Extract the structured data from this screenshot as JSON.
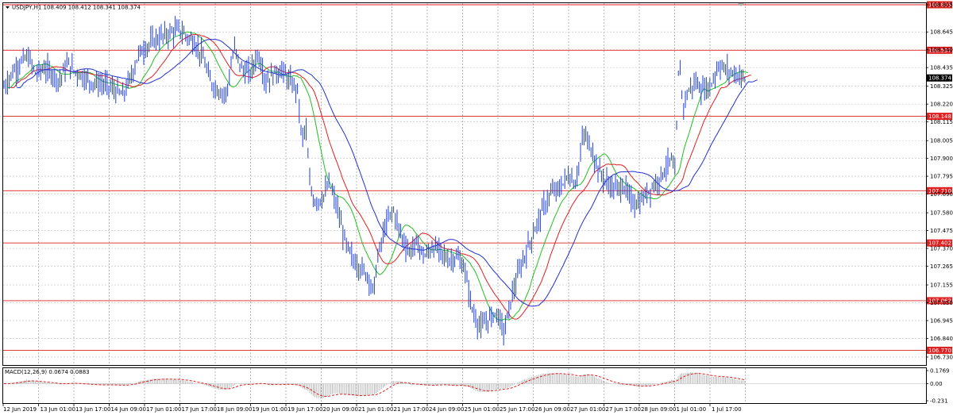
{
  "chart_data": {
    "type": "line",
    "main": {
      "header": "USDJPY,H1  108.409 108.412 108.341 108.374",
      "bid_label": "108.374",
      "bid": 108.374,
      "ylim": [
        106.73,
        108.805
      ],
      "yticks": [
        "108.805",
        "108.645",
        "108.540",
        "108.435",
        "108.325",
        "108.220",
        "108.115",
        "108.005",
        "107.900",
        "107.795",
        "107.690",
        "107.580",
        "107.475",
        "107.370",
        "107.265",
        "107.155",
        "107.050",
        "106.945",
        "106.840",
        "106.730"
      ],
      "levels": [
        {
          "label": "108.805",
          "value": 108.805
        },
        {
          "label": "108.537",
          "value": 108.537
        },
        {
          "label": "108.148",
          "value": 108.148
        },
        {
          "label": "107.710",
          "value": 107.71
        },
        {
          "label": "107.402",
          "value": 107.402
        },
        {
          "label": "107.062",
          "value": 107.062
        },
        {
          "label": "106.770",
          "value": 106.77
        }
      ],
      "line_colors": {
        "price": "#1f3fd6",
        "level": "#e02020",
        "ma_fast": "#22c022",
        "ma_mid": "#e02020",
        "ma_slow": "#2030d0"
      },
      "price_anchors": [
        [
          0,
          108.32
        ],
        [
          10,
          108.4
        ],
        [
          20,
          108.46
        ],
        [
          30,
          108.5
        ],
        [
          40,
          108.4
        ],
        [
          50,
          108.43
        ],
        [
          60,
          108.4
        ],
        [
          70,
          108.36
        ],
        [
          80,
          108.46
        ],
        [
          90,
          108.41
        ],
        [
          100,
          108.38
        ],
        [
          110,
          108.35
        ],
        [
          120,
          108.34
        ],
        [
          130,
          108.33
        ],
        [
          140,
          108.3
        ],
        [
          150,
          108.27
        ],
        [
          160,
          108.38
        ],
        [
          170,
          108.52
        ],
        [
          180,
          108.56
        ],
        [
          190,
          108.6
        ],
        [
          200,
          108.62
        ],
        [
          210,
          108.64
        ],
        [
          220,
          108.66
        ],
        [
          230,
          108.62
        ],
        [
          240,
          108.58
        ],
        [
          250,
          108.5
        ],
        [
          260,
          108.35
        ],
        [
          270,
          108.3
        ],
        [
          280,
          108.28
        ],
        [
          290,
          108.55
        ],
        [
          300,
          108.42
        ],
        [
          310,
          108.4
        ],
        [
          320,
          108.52
        ],
        [
          330,
          108.35
        ],
        [
          340,
          108.4
        ],
        [
          350,
          108.42
        ],
        [
          360,
          108.35
        ],
        [
          370,
          108.3
        ],
        [
          375,
          108.0
        ],
        [
          380,
          108.1
        ],
        [
          385,
          107.75
        ],
        [
          390,
          107.65
        ],
        [
          400,
          107.66
        ],
        [
          410,
          107.75
        ],
        [
          420,
          107.6
        ],
        [
          430,
          107.4
        ],
        [
          440,
          107.3
        ],
        [
          450,
          107.25
        ],
        [
          460,
          107.2
        ],
        [
          465,
          107.1
        ],
        [
          470,
          107.3
        ],
        [
          480,
          107.5
        ],
        [
          490,
          107.6
        ],
        [
          500,
          107.45
        ],
        [
          510,
          107.35
        ],
        [
          520,
          107.4
        ],
        [
          530,
          107.32
        ],
        [
          540,
          107.38
        ],
        [
          550,
          107.35
        ],
        [
          560,
          107.3
        ],
        [
          570,
          107.32
        ],
        [
          580,
          107.25
        ],
        [
          590,
          107.0
        ],
        [
          600,
          106.9
        ],
        [
          610,
          106.95
        ],
        [
          620,
          107.0
        ],
        [
          630,
          106.88
        ],
        [
          640,
          107.1
        ],
        [
          650,
          107.25
        ],
        [
          660,
          107.38
        ],
        [
          670,
          107.5
        ],
        [
          680,
          107.62
        ],
        [
          690,
          107.7
        ],
        [
          700,
          107.72
        ],
        [
          710,
          107.8
        ],
        [
          720,
          107.75
        ],
        [
          730,
          108.05
        ],
        [
          740,
          107.95
        ],
        [
          750,
          107.82
        ],
        [
          760,
          107.75
        ],
        [
          770,
          107.72
        ],
        [
          780,
          107.74
        ],
        [
          790,
          107.65
        ],
        [
          800,
          107.63
        ],
        [
          810,
          107.7
        ],
        [
          820,
          107.75
        ],
        [
          830,
          107.82
        ],
        [
          840,
          107.9
        ],
        [
          845,
          107.8
        ],
        [
          850,
          108.5
        ],
        [
          855,
          108.2
        ],
        [
          860,
          108.28
        ],
        [
          870,
          108.35
        ],
        [
          880,
          108.3
        ],
        [
          890,
          108.33
        ],
        [
          900,
          108.45
        ],
        [
          910,
          108.42
        ],
        [
          920,
          108.4
        ],
        [
          935,
          108.37
        ]
      ]
    },
    "macd": {
      "label": "MACD(12,26,9)  0.0674  0.0883",
      "value": 0.0674,
      "signal": 0.0883,
      "ylim": [
        -0.231,
        0.1769
      ],
      "yticks": [
        "0.1769",
        "0.00",
        "-0.231"
      ],
      "colors": {
        "histogram": "#a8a8a8",
        "signal": "#e02020"
      }
    },
    "x_ticks": [
      "12 Jun 2019",
      "13 Jun 01:00",
      "13 Jun 17:00",
      "14 Jun 09:00",
      "17 Jun 01:00",
      "17 Jun 17:00",
      "18 Jun 09:00",
      "19 Jun 01:00",
      "19 Jun 17:00",
      "20 Jun 09:00",
      "21 Jun 01:00",
      "21 Jun 17:00",
      "24 Jun 09:00",
      "25 Jun 01:00",
      "25 Jun 17:00",
      "26 Jun 09:00",
      "27 Jun 01:00",
      "27 Jun 17:00",
      "28 Jun 09:00",
      "1 Jul 01:00",
      "1 Jul 17:00"
    ],
    "grid": true
  }
}
